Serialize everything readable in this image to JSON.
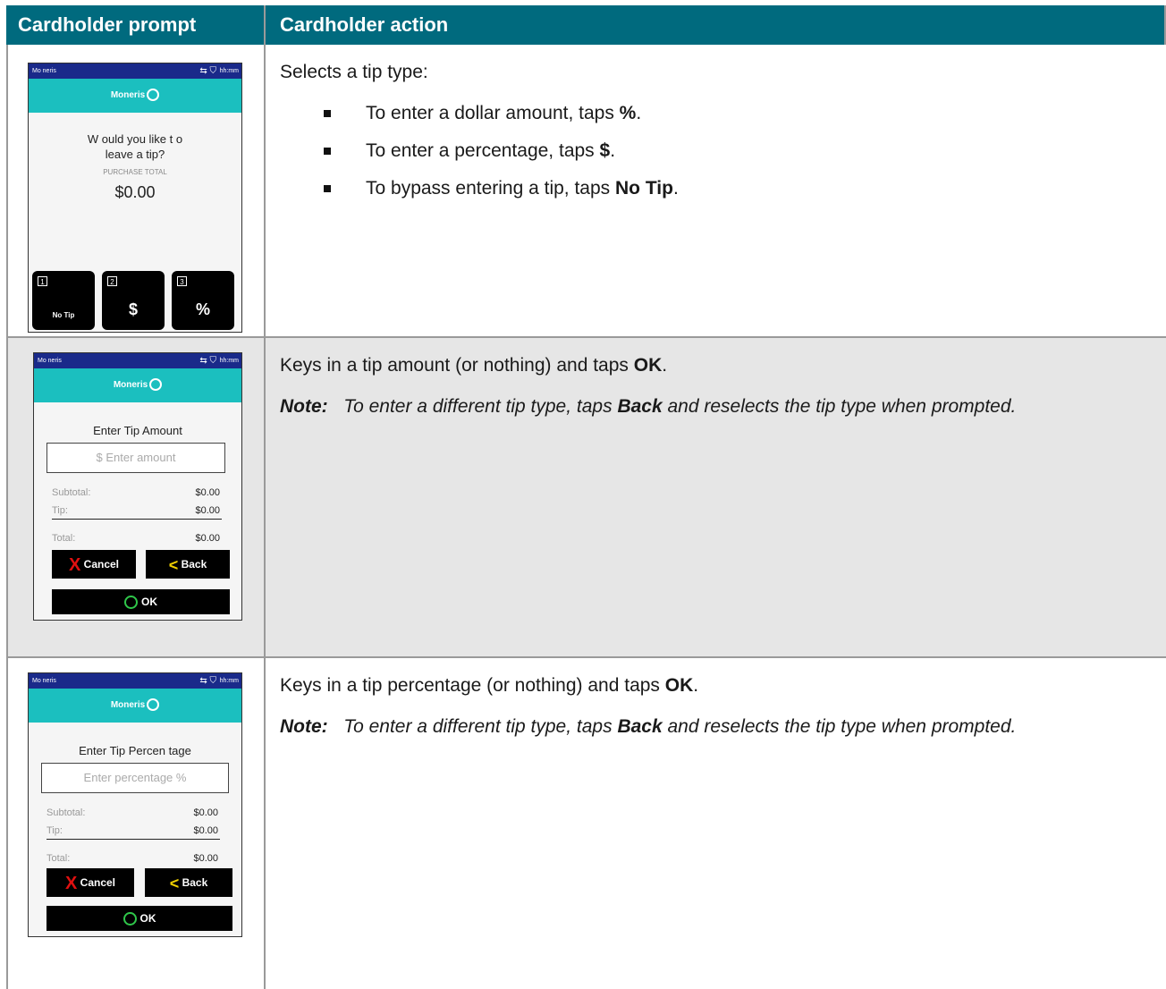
{
  "header": {
    "col1": "Cardholder prompt",
    "col2": "Cardholder action"
  },
  "device": {
    "status_left": "Mo neris",
    "status_time": "hh:mm",
    "brand": "Moneris"
  },
  "row1": {
    "screen": {
      "line1": "W ould you like t o",
      "line2": "leave a tip?",
      "purchase_label": "PURCHASE TOTAL",
      "amount": "$0.00",
      "buttons": [
        {
          "num": "1",
          "label": "No Tip"
        },
        {
          "num": "2",
          "label": "$"
        },
        {
          "num": "3",
          "label": "%"
        }
      ]
    },
    "action": {
      "intro": "Selects a tip type:",
      "bullets": [
        {
          "pre": "To enter a dollar amount, taps ",
          "bold": "%",
          "post": "."
        },
        {
          "pre": "To enter a percentage, taps ",
          "bold": "$",
          "post": "."
        },
        {
          "pre": "To bypass entering a tip, taps ",
          "bold": "No Tip",
          "post": "."
        }
      ]
    }
  },
  "row2": {
    "screen": {
      "title": "Enter Tip Amount",
      "placeholder": "$ Enter amount",
      "subtotal_label": "Subtotal:",
      "subtotal": "$0.00",
      "tip_label": "Tip:",
      "tip": "$0.00",
      "total_label": "Total:",
      "total": "$0.00",
      "cancel": "Cancel",
      "back": "Back",
      "ok": "OK"
    },
    "action": {
      "pre": "Keys in a tip amount (or nothing) and taps ",
      "bold": "OK",
      "post": ".",
      "note_label": "Note:",
      "note_pre": "To enter a different tip type, taps ",
      "note_bold": "Back",
      "note_post": " and reselects the tip type when prompted."
    }
  },
  "row3": {
    "screen": {
      "title": "Enter Tip Percen tage",
      "placeholder": "Enter percentage %",
      "subtotal_label": "Subtotal:",
      "subtotal": "$0.00",
      "tip_label": "Tip:",
      "tip": "$0.00",
      "total_label": "Total:",
      "total": "$0.00",
      "cancel": "Cancel",
      "back": "Back",
      "ok": "OK"
    },
    "action": {
      "pre": "Keys in a tip percentage (or nothing) and taps ",
      "bold": "OK",
      "post": ".",
      "note_label": "Note:",
      "note_pre": "To enter a different tip type, taps ",
      "note_bold": "Back",
      "note_post": " and reselects the tip type when prompted."
    }
  }
}
